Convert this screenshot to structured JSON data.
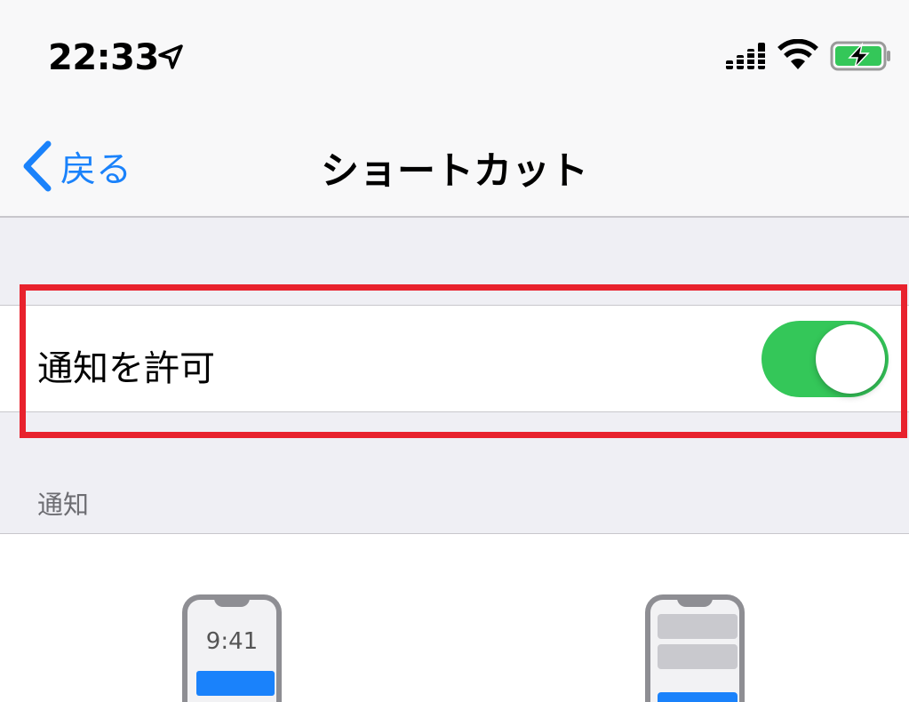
{
  "status_bar": {
    "time": "22:33",
    "icons": [
      "location-arrow-icon",
      "cellular-signal-icon",
      "wifi-icon",
      "battery-charging-icon"
    ]
  },
  "nav": {
    "back_label": "戻る",
    "title": "ショートカット"
  },
  "settings": {
    "allow_notifications_label": "通知を許可",
    "allow_notifications_enabled": true
  },
  "notifications_section": {
    "header": "通知",
    "lock_screen_preview_time": "9:41"
  },
  "colors": {
    "accent": "#1a82fb",
    "switch_on": "#34c759",
    "highlight": "#e8222d"
  }
}
